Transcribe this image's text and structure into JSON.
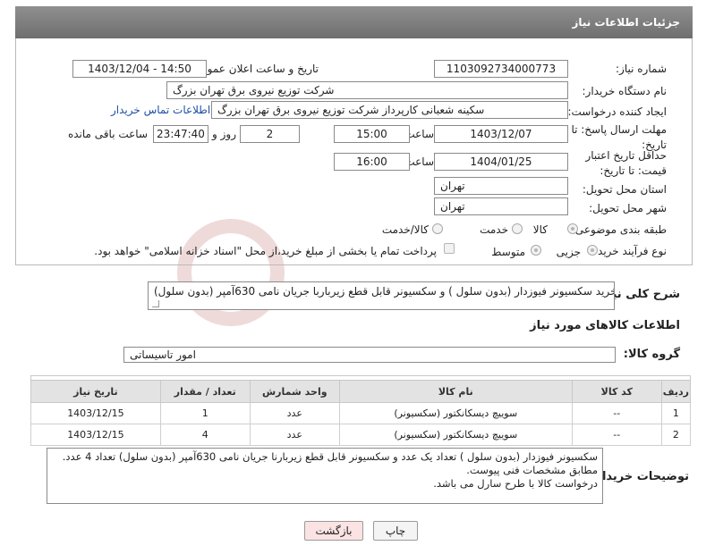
{
  "header": {
    "title": "جزئیات اطلاعات نیاز"
  },
  "fields": {
    "need_number_label": "شماره نیاز:",
    "need_number": "1103092734000773",
    "announce_label": "تاریخ و ساعت اعلان عمومی:",
    "announce_value": "1403/12/04 - 14:50",
    "buyer_org_label": "نام دستگاه خریدار:",
    "buyer_org": "شرکت توزیع نیروی برق تهران بزرگ",
    "creator_label": "ایجاد کننده درخواست:",
    "creator": "سکینه شعبانی کارپرداز شرکت توزیع نیروی برق تهران بزرگ",
    "contact_link": "اطلاعات تماس خریدار",
    "deadline_label": "مهلت ارسال پاسخ: تا تاریخ:",
    "deadline_date": "1403/12/07",
    "time_label": "ساعت",
    "deadline_time": "15:00",
    "days_value": "2",
    "days_label": "روز و",
    "remaining_value": "23:47:40",
    "remaining_label": "ساعت باقی مانده",
    "validity_label": "حداقل تاریخ اعتبار قیمت: تا تاریخ:",
    "validity_date": "1404/01/25",
    "validity_time_label": "ساعت",
    "validity_time": "16:00",
    "province_label": "استان محل تحویل:",
    "province": "تهران",
    "city_label": "شهر محل تحویل:",
    "city": "تهران",
    "category_label": "طبقه بندی موضوعی:",
    "category_options": [
      "کالا",
      "خدمت",
      "کالا/خدمت"
    ],
    "process_label": "نوع فرآیند خرید :",
    "process_options": [
      "جزیی",
      "متوسط"
    ],
    "payment_note": "پرداخت تمام یا بخشی از مبلغ خرید،از محل \"اسناد خزانه اسلامی\" خواهد بود."
  },
  "summary": {
    "label": "شرح کلی نیاز:",
    "text": "خرید سکسیونر فیوزدار (بدون سلول ) و سکسیونر قابل قطع زیرباربا جریان نامی 630آمپر (بدون سلول)"
  },
  "goods_section": {
    "title": "اطلاعات کالاهای مورد نیاز",
    "group_label": "گروه کالا:",
    "group_value": "امور تاسیساتی"
  },
  "table": {
    "headers": [
      "ردیف",
      "کد کالا",
      "نام کالا",
      "واحد شمارش",
      "تعداد / مقدار",
      "تاریخ نیاز"
    ],
    "rows": [
      [
        "1",
        "--",
        "سوییچ دیسکانکتور (سکسیونر)",
        "عدد",
        "1",
        "1403/12/15"
      ],
      [
        "2",
        "--",
        "سوییچ دیسکانکتور (سکسیونر)",
        "عدد",
        "4",
        "1403/12/15"
      ]
    ]
  },
  "buyer_notes": {
    "label": "توضیحات خریدار:",
    "line1": "سکسیونر فیوزدار (بدون سلول ) تعداد یک عدد و سکسیونر قابل قطع زیربارنا جریان نامی 630آمپر (بدون سلول) تعداد 4 عدد.",
    "line2": "مطابق مشخصات فنی پیوست.",
    "line3": "درخواست کالا با طرح سارل می باشد."
  },
  "buttons": {
    "print": "چاپ",
    "back": "بازگشت"
  },
  "colors": {
    "header_bg": "#7f7f7f",
    "back_btn_bg": "#fbe3e3",
    "link": "#1f4fa8"
  }
}
